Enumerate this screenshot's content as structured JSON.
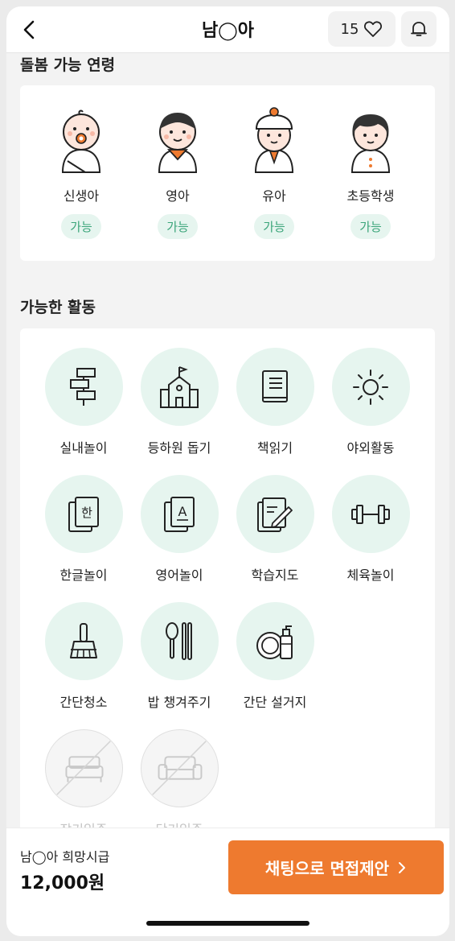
{
  "header": {
    "title": "남◯아",
    "like_count": "15"
  },
  "age_section": {
    "title": "돌봄 가능 연령",
    "items": [
      {
        "label": "신생아",
        "status": "가능"
      },
      {
        "label": "영아",
        "status": "가능"
      },
      {
        "label": "유아",
        "status": "가능"
      },
      {
        "label": "초등학생",
        "status": "가능"
      }
    ]
  },
  "activity_section": {
    "title": "가능한 활동",
    "items": [
      {
        "label": "실내놀이",
        "icon": "signpost-icon",
        "available": true
      },
      {
        "label": "등하원 돕기",
        "icon": "school-icon",
        "available": true
      },
      {
        "label": "책읽기",
        "icon": "book-icon",
        "available": true
      },
      {
        "label": "야외활동",
        "icon": "sun-icon",
        "available": true
      },
      {
        "label": "한글놀이",
        "icon": "hangul-card-icon",
        "available": true
      },
      {
        "label": "영어놀이",
        "icon": "english-card-icon",
        "available": true
      },
      {
        "label": "학습지도",
        "icon": "study-pencil-icon",
        "available": true
      },
      {
        "label": "체육놀이",
        "icon": "dumbbell-icon",
        "available": true
      },
      {
        "label": "간단청소",
        "icon": "broom-icon",
        "available": true
      },
      {
        "label": "밥 챙겨주기",
        "icon": "spoon-chopsticks-icon",
        "available": true
      },
      {
        "label": "간단 설거지",
        "icon": "dish-soap-icon",
        "available": true
      },
      {
        "label": "장기입주",
        "icon": "bed-icon",
        "available": false
      },
      {
        "label": "단기입주",
        "icon": "sofa-icon",
        "available": false
      }
    ]
  },
  "bottom_bar": {
    "wage_label": "남◯아 희망시급",
    "wage_value": "12,000원",
    "cta_label": "채팅으로 면접제안"
  },
  "colors": {
    "accent": "#ee7a2f",
    "available_green": "#3ba57a",
    "icon_bg": "#e6f5ef"
  }
}
